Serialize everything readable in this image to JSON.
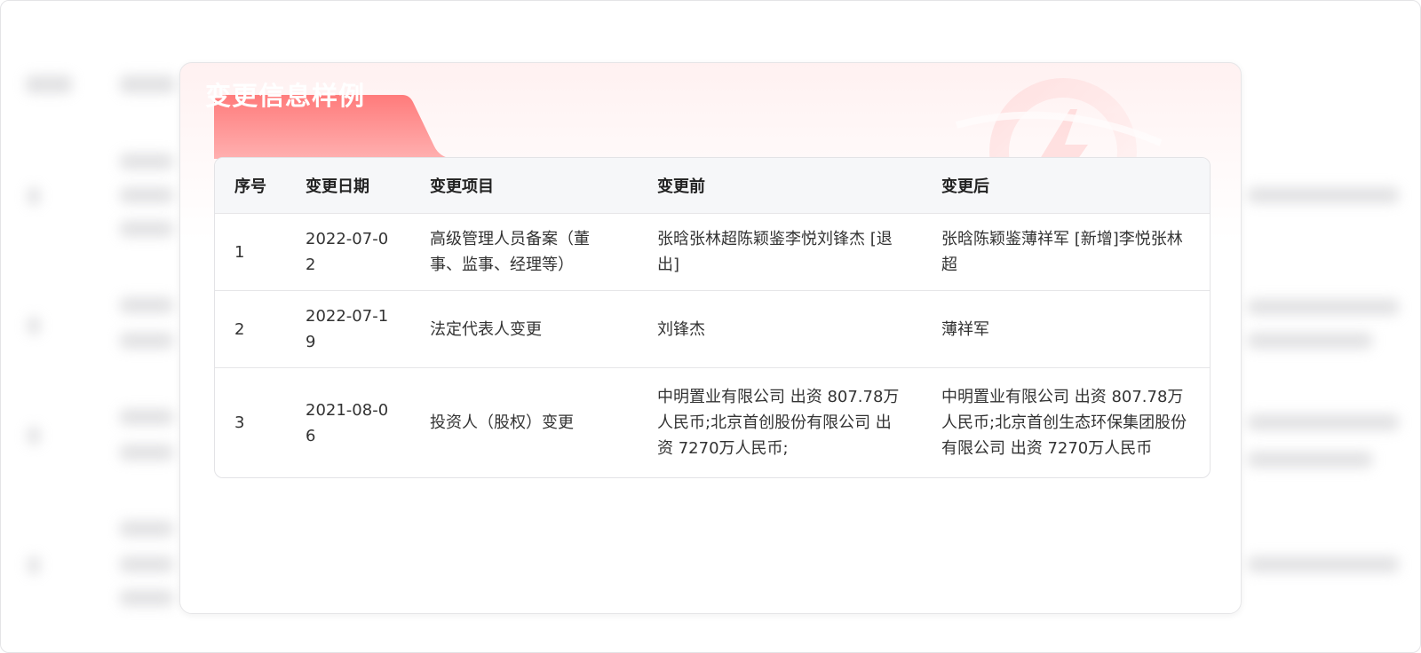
{
  "card": {
    "title": "变更信息样例"
  },
  "table": {
    "headers": [
      "序号",
      "变更日期",
      "变更项目",
      "变更前",
      "变更后"
    ],
    "rows": [
      {
        "index": "1",
        "date": "2022-07-02",
        "item": "高级管理人员备案（董事、监事、经理等）",
        "before": "张晗张林超陈颖鉴李悦刘锋杰 [退出]",
        "after": "张晗陈颖鉴薄祥军 [新增]李悦张林超"
      },
      {
        "index": "2",
        "date": "2022-07-19",
        "item": "法定代表人变更",
        "before": "刘锋杰",
        "after": "薄祥军"
      },
      {
        "index": "3",
        "date": "2021-08-06",
        "item": "投资人（股权）变更",
        "before": "中明置业有限公司 出资 807.78万人民币;北京首创股份有限公司 出资 7270万人民币;",
        "after": "中明置业有限公司 出资 807.78万人民币;北京首创生态环保集团股份有限公司 出资 7270万人民币"
      }
    ]
  },
  "colors": {
    "accent": "#ff7b7b",
    "accent_light": "#ffb0b0",
    "header_bg": "#f6f7f9"
  },
  "icons": {
    "watermark": "lightning-icon"
  }
}
